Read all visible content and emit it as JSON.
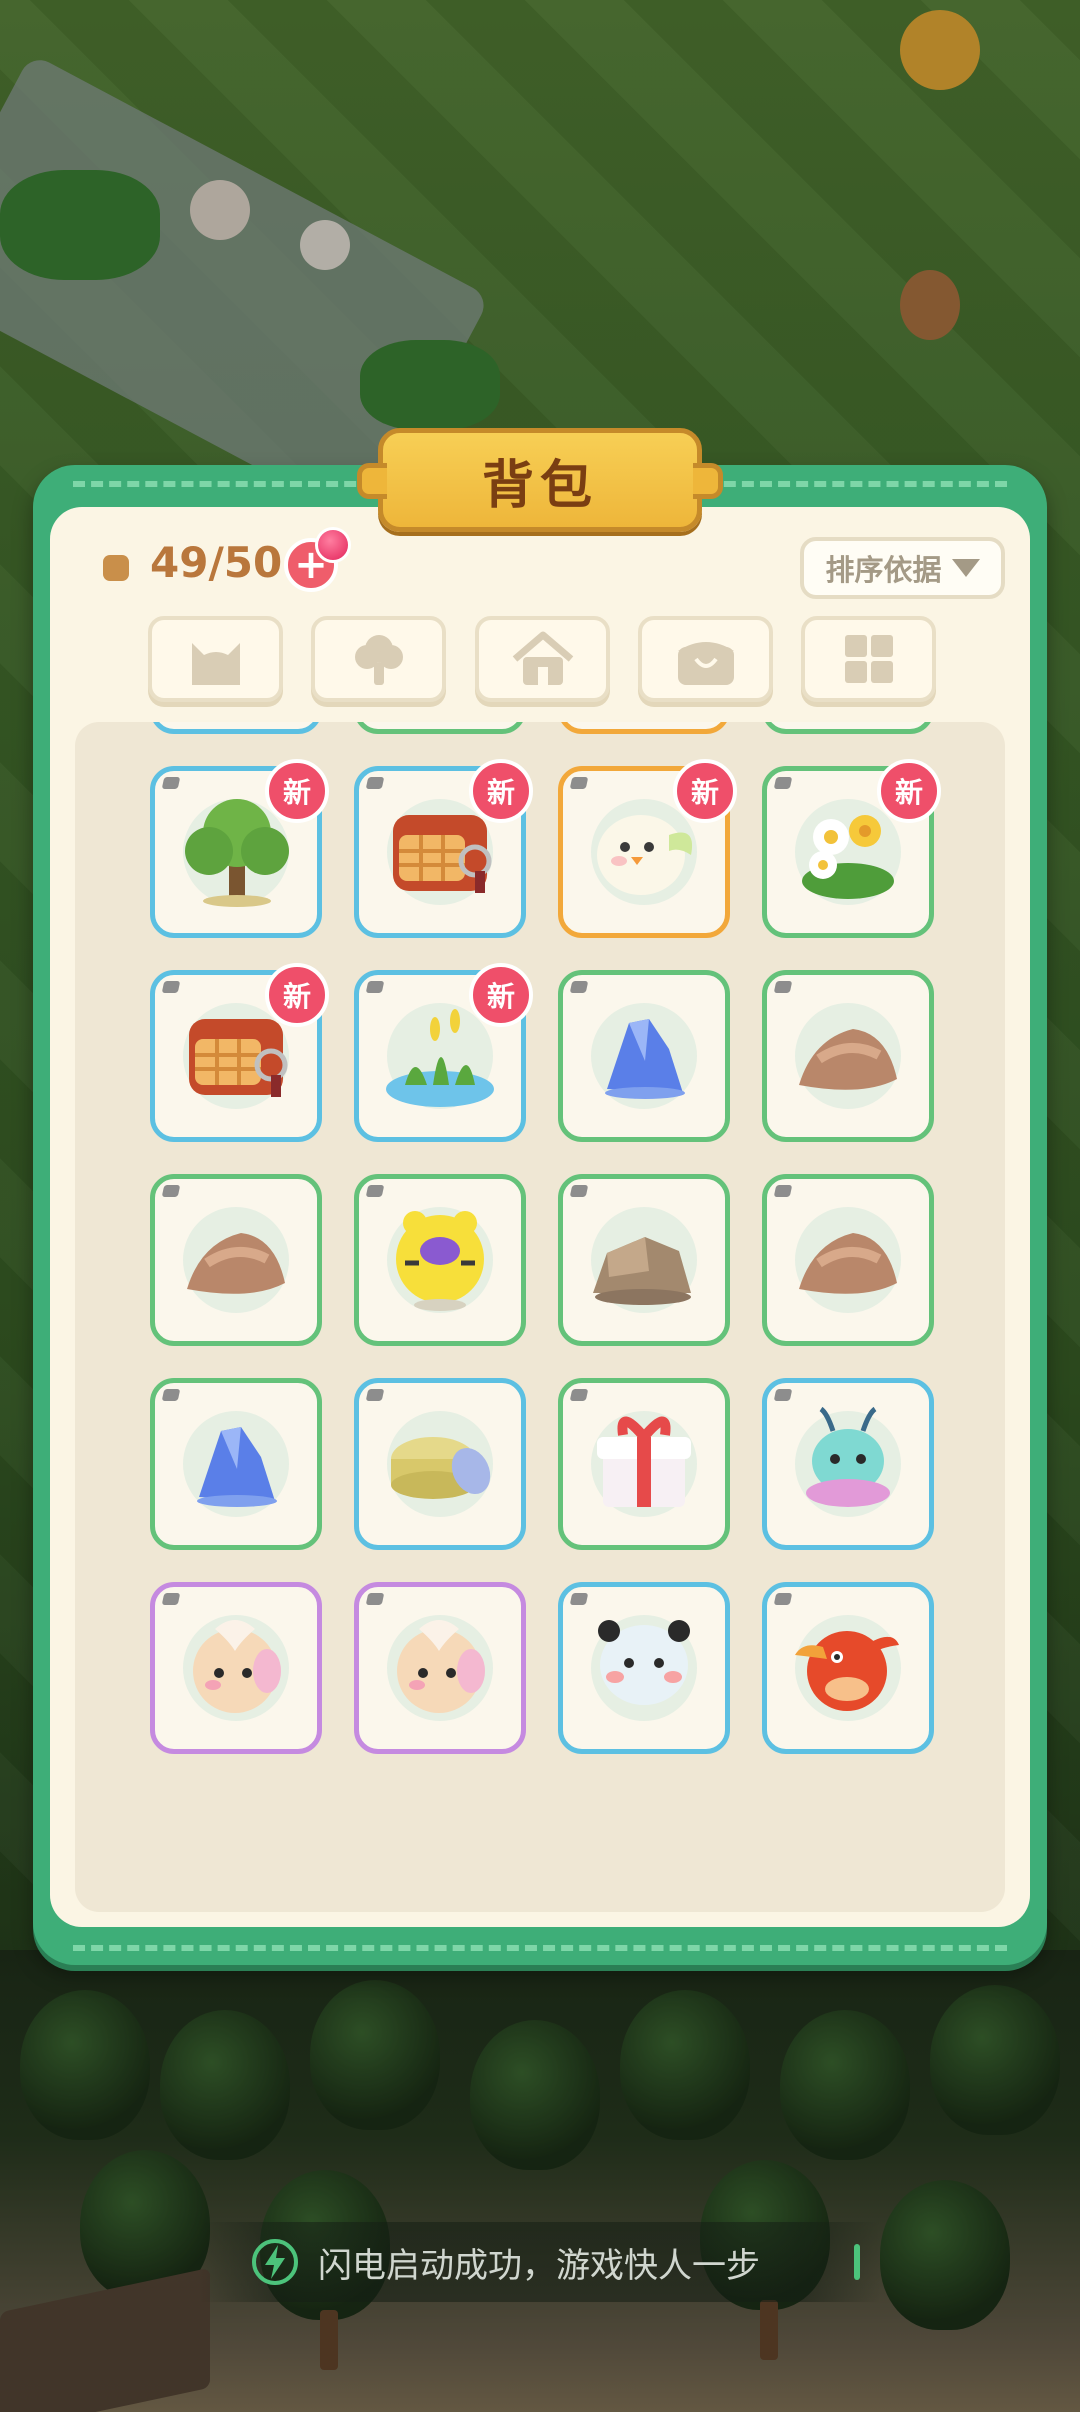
{
  "title": "背包",
  "capacity": {
    "text": "49/50"
  },
  "add_button": {
    "label": "+"
  },
  "sort_button": {
    "label": "排序依据"
  },
  "tabs": [
    {
      "name": "cat-icon"
    },
    {
      "name": "tree-icon"
    },
    {
      "name": "house-icon"
    },
    {
      "name": "treasure-chest-icon"
    },
    {
      "name": "grid-icon"
    }
  ],
  "new_badge_text": "新",
  "items": [
    {
      "icon": "tree-branch-icon",
      "border": "blue",
      "new": false
    },
    {
      "icon": "swirl-orb-icon",
      "border": "green",
      "new": false
    },
    {
      "icon": "white-bird-icon",
      "border": "orange",
      "new": false
    },
    {
      "icon": "red-potion-icon",
      "border": "green",
      "new": false
    },
    {
      "icon": "green-tree-icon",
      "border": "blue",
      "new": true
    },
    {
      "icon": "toaster-box-icon",
      "border": "blue",
      "new": true
    },
    {
      "icon": "white-bird-icon",
      "border": "orange",
      "new": true
    },
    {
      "icon": "flower-bush-icon",
      "border": "green",
      "new": true
    },
    {
      "icon": "toaster-box-icon",
      "border": "blue",
      "new": true
    },
    {
      "icon": "pond-plants-icon",
      "border": "blue",
      "new": true
    },
    {
      "icon": "blue-crystal-icon",
      "border": "green",
      "new": false
    },
    {
      "icon": "brown-rock-icon",
      "border": "green",
      "new": false
    },
    {
      "icon": "brown-rock-icon",
      "border": "green",
      "new": false
    },
    {
      "icon": "yellow-tiger-icon",
      "border": "green",
      "new": false
    },
    {
      "icon": "stone-pile-icon",
      "border": "green",
      "new": false
    },
    {
      "icon": "brown-rock-icon",
      "border": "green",
      "new": false
    },
    {
      "icon": "blue-crystal-icon",
      "border": "green",
      "new": false
    },
    {
      "icon": "cream-jar-icon",
      "border": "blue",
      "new": false
    },
    {
      "icon": "gift-box-icon",
      "border": "green",
      "new": false
    },
    {
      "icon": "jellyfish-pet-icon",
      "border": "blue",
      "new": false
    },
    {
      "icon": "sheep-pet-icon",
      "border": "purple",
      "new": false
    },
    {
      "icon": "sheep-pet-icon",
      "border": "purple",
      "new": false
    },
    {
      "icon": "panda-ball-icon",
      "border": "blue",
      "new": false
    },
    {
      "icon": "red-bird-icon",
      "border": "blue",
      "new": false
    }
  ],
  "toast": {
    "text": "闪电启动成功，游戏快人一步"
  },
  "colors": {
    "panel": "#3eae78",
    "inner": "#fbf5e4",
    "title_plate": "#eeb63a",
    "new_badge": "#ef4f6a",
    "border_blue": "#5cc0e2",
    "border_green": "#64c27a",
    "border_orange": "#f2a83a",
    "border_purple": "#c58ae0"
  }
}
